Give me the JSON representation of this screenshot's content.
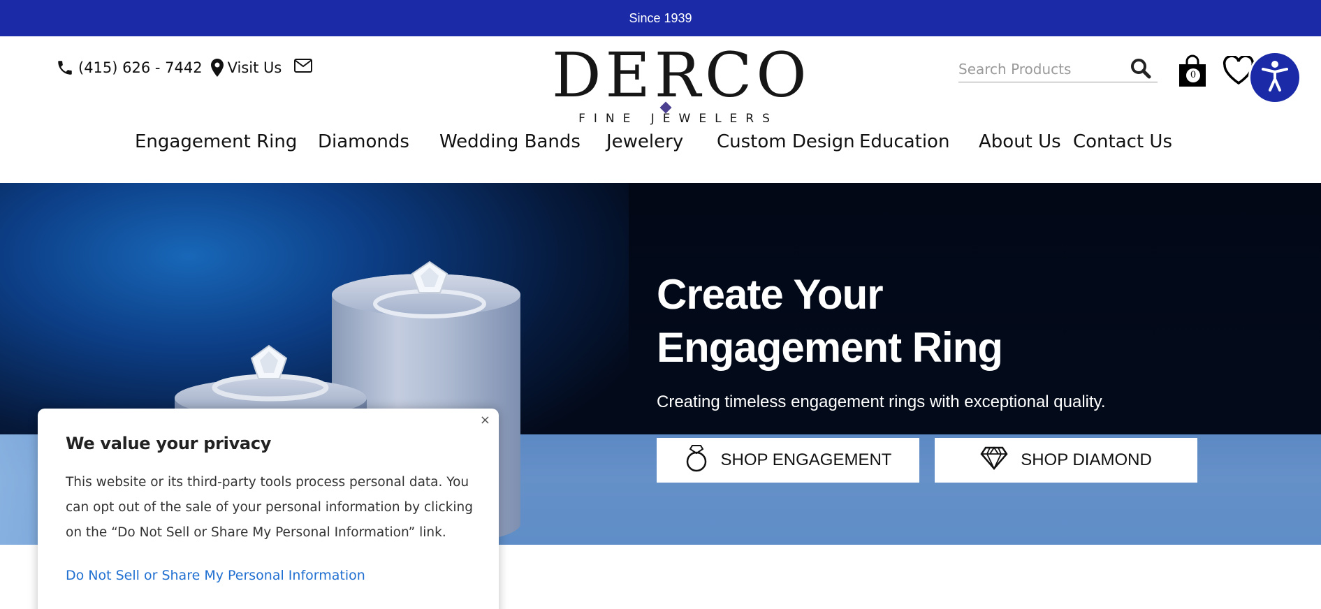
{
  "topbar": {
    "text": "Since 1939"
  },
  "header": {
    "phone": "(415) 626 - 7442",
    "visit": "Visit Us",
    "logo_main": "DERCO",
    "logo_sub": "FINE JEWELERS",
    "search_placeholder": "Search Products",
    "cart_count": "0"
  },
  "nav": {
    "items": [
      "Engagement Ring",
      "Diamonds",
      "Wedding Bands",
      "Jewelery",
      "Custom Design",
      "Education",
      "About Us",
      "Contact Us"
    ]
  },
  "hero": {
    "title_line1": "Create Your",
    "title_line2": "Engagement Ring",
    "tagline": "Creating timeless engagement rings with exceptional quality.",
    "btn_engagement": "SHOP ENGAGEMENT",
    "btn_diamond": "SHOP DIAMOND"
  },
  "privacy": {
    "title": "We value your privacy",
    "body": "This website or its third-party tools process personal data. You can opt out of the sale of your personal information by clicking on the “Do Not Sell or Share My Personal Information” link.",
    "link": "Do Not Sell or Share My Personal Information",
    "close": "×"
  },
  "colors": {
    "brand_blue": "#1b2ba8",
    "link_blue": "#1f6fd1",
    "hero_dark": "#030a1a",
    "hero_floor": "#5f8dc7"
  },
  "icons": [
    "phone-icon",
    "map-pin-icon",
    "mail-icon",
    "search-icon",
    "shopping-bag-icon",
    "heart-icon",
    "account-icon",
    "accessibility-icon",
    "ring-icon",
    "diamond-icon",
    "close-icon"
  ]
}
